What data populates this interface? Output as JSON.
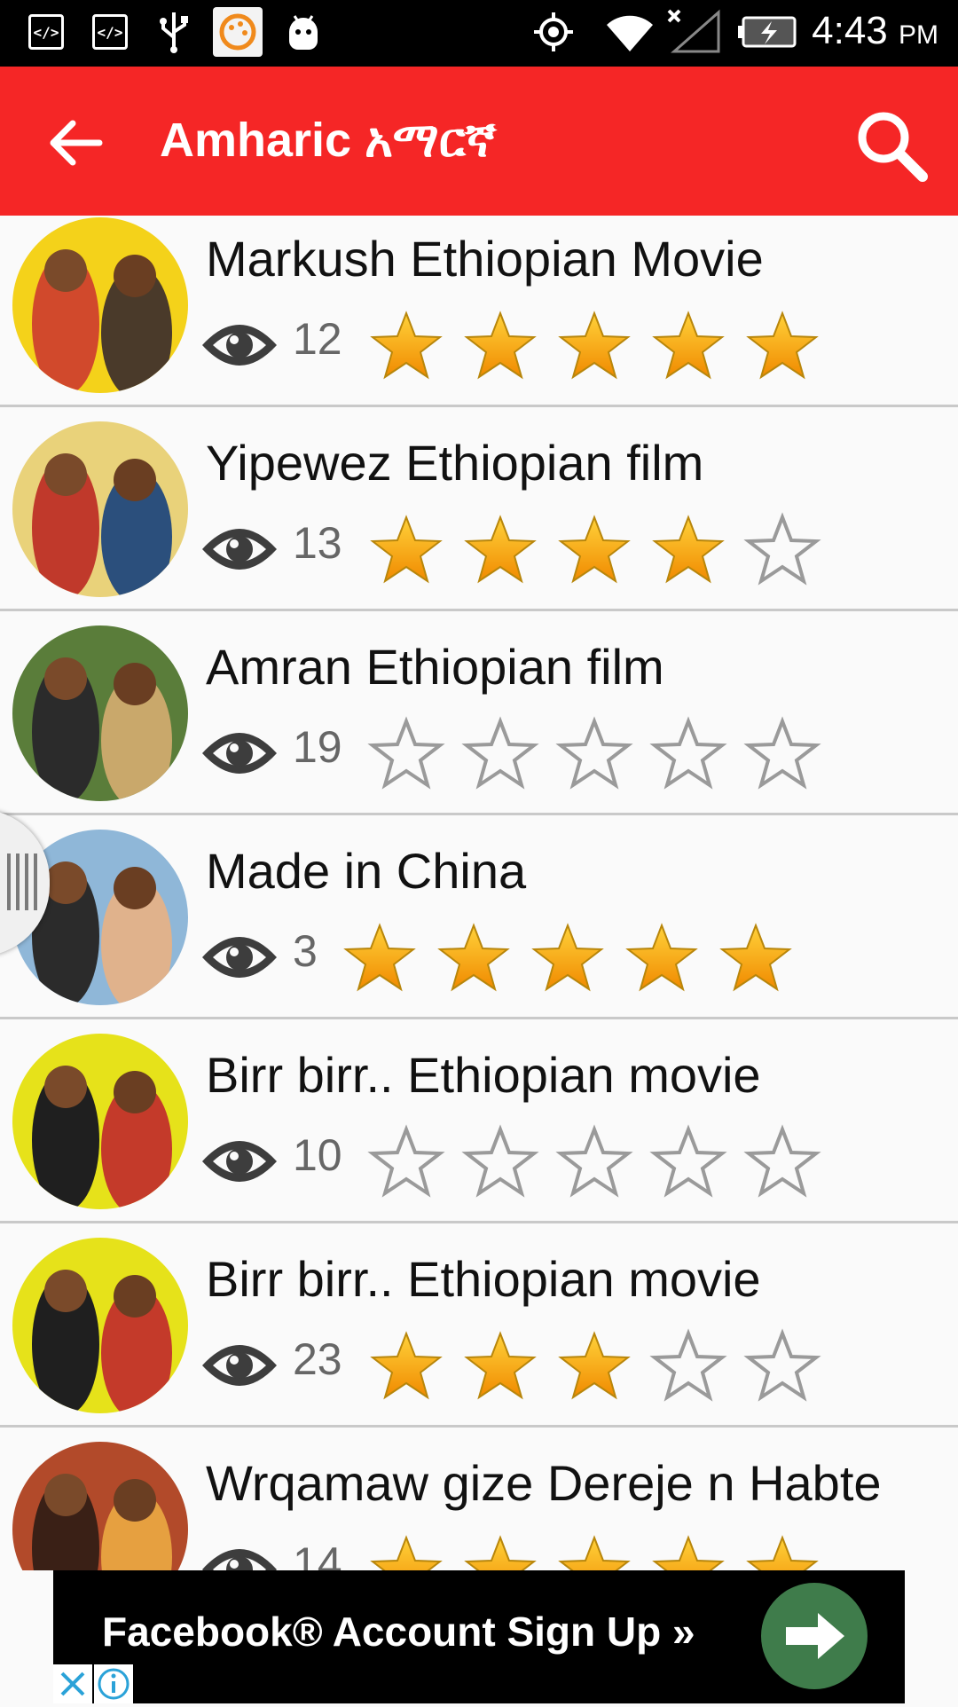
{
  "status_bar": {
    "time": "4:43",
    "ampm": "PM",
    "icons": [
      "code-icon",
      "code-icon",
      "usb-icon",
      "app-notification-icon",
      "android-icon",
      "gps-icon",
      "wifi-icon",
      "signal-icon",
      "battery-charging-icon"
    ],
    "code_glyph": "</>"
  },
  "app_bar": {
    "title": "Amharic አማርኛ",
    "back_icon": "arrow-back-icon",
    "search_icon": "search-icon",
    "color": "#f52626"
  },
  "list": {
    "items": [
      {
        "title": "Markush Ethiopian Movie",
        "views": "12",
        "rating": 5
      },
      {
        "title": "Yipewez Ethiopian film",
        "views": "13",
        "rating": 4
      },
      {
        "title": "Amran Ethiopian film",
        "views": "19",
        "rating": 0
      },
      {
        "title": "Made in China",
        "views": "3",
        "rating": 5
      },
      {
        "title": "Birr birr.. Ethiopian movie",
        "views": "10",
        "rating": 0
      },
      {
        "title": "Birr birr.. Ethiopian movie",
        "views": "23",
        "rating": 3
      },
      {
        "title": "Wrqamaw gize Dereje n Habte",
        "views": "14",
        "rating": 5
      }
    ]
  },
  "ad": {
    "text": "Facebook® Account Sign Up »",
    "button_color": "#3f7c4b"
  }
}
